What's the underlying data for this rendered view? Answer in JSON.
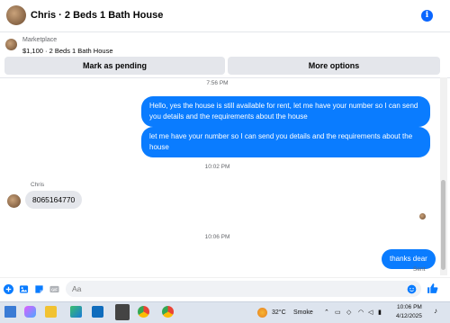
{
  "header": {
    "title": "Chris · 2 Beds 1 Bath House"
  },
  "marketplace": {
    "label": "Marketplace",
    "listing": "$1,100 · 2 Beds 1 Bath House"
  },
  "actions": {
    "pending": "Mark as pending",
    "more": "More options"
  },
  "messages": {
    "ts1": "7:56 PM",
    "out1": "Hello, yes the house is still available for rent, let me have your number so I can send you details and the requirements about the house",
    "out2": "let me have your number so I can send you details and the requirements about the house",
    "ts2": "10:02 PM",
    "sender": "Chris",
    "in1": "8065164770",
    "ts3": "10:06 PM",
    "out3": "thanks dear",
    "status": "Sent"
  },
  "composer": {
    "placeholder": "Aa"
  },
  "taskbar": {
    "weather_temp": "32°C",
    "weather_desc": "Smoke",
    "time": "10:06 PM",
    "date": "4/12/2025"
  },
  "colors": {
    "accent": "#0a7cff",
    "bubble_in": "#e4e6eb"
  }
}
